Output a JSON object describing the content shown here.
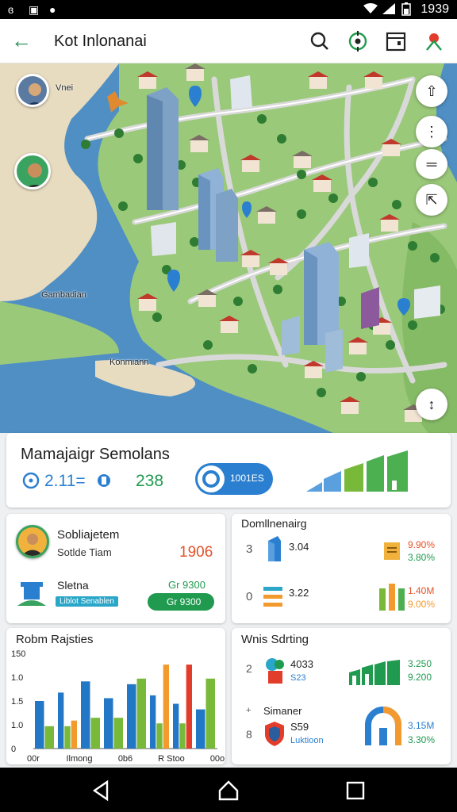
{
  "status_bar": {
    "time": "1939"
  },
  "app_bar": {
    "title": "Kot Inlonanai"
  },
  "map": {
    "labels": {
      "avatar_top": "Vnei",
      "region_1": "Gambadian",
      "region_2": "Konmiann"
    }
  },
  "summary": {
    "title": "Mamajaigr Semolans",
    "stat_1": "2.11=",
    "stat_2": "238",
    "pill": "1001ES"
  },
  "profile_card": {
    "name": "Sobliajetem",
    "subtitle": "Sotlde Tiam",
    "number": "1906",
    "item_label": "Sletna",
    "item_sub": "Liblot Senablen",
    "badge": "Gr 9300"
  },
  "domain_card": {
    "title": "Domllnenairg",
    "rows": [
      {
        "num": "3",
        "value": "3.04",
        "stat_a": "9.90%",
        "stat_b": "3.80%"
      },
      {
        "num": "0",
        "value": "3.22",
        "stat_a": "1.40M",
        "stat_b": "9.00%"
      }
    ]
  },
  "chart": {
    "title": "Robm Rajsties",
    "y_ticks": [
      "150",
      "1.0",
      "1.5",
      "1.0",
      "0"
    ],
    "x_ticks": [
      "00r",
      "Ilmong",
      "0b6",
      "R Stoo",
      "00o"
    ]
  },
  "chart_data": {
    "type": "bar",
    "title": "Robm Rajsties",
    "categories": [
      "1",
      "2",
      "3",
      "4",
      "5",
      "6",
      "7",
      "8"
    ],
    "series": [
      {
        "values": [
          85,
          100,
          120,
          90,
          115,
          95,
          80,
          70
        ],
        "color": "#2277c7"
      },
      {
        "values": [
          40,
          40,
          55,
          55,
          125,
          45,
          45,
          125
        ],
        "color": "#79b93a"
      },
      {
        "values": [
          0,
          50,
          0,
          0,
          0,
          150,
          0,
          0
        ],
        "color": "#f29a2e"
      },
      {
        "values": [
          0,
          0,
          0,
          0,
          0,
          0,
          150,
          0
        ],
        "color": "#e23c2a"
      }
    ],
    "ylim": [
      0,
      170
    ]
  },
  "wins_card": {
    "title": "Wnis Sdrting",
    "num_1": "2",
    "value_1": "4033",
    "sub_1": "S23",
    "stat_1a": "3.250",
    "stat_1b": "9.200",
    "label_2": "Simaner",
    "num_2": "8",
    "value_2": "S59",
    "sub_2": "Luktioon",
    "stat_2a": "3.15M",
    "stat_2b": "3.30%"
  },
  "colors": {
    "accent_green": "#1f9a4f",
    "accent_blue": "#2a7fd0",
    "water": "#4f8fc4",
    "land": "#9bc97a"
  }
}
